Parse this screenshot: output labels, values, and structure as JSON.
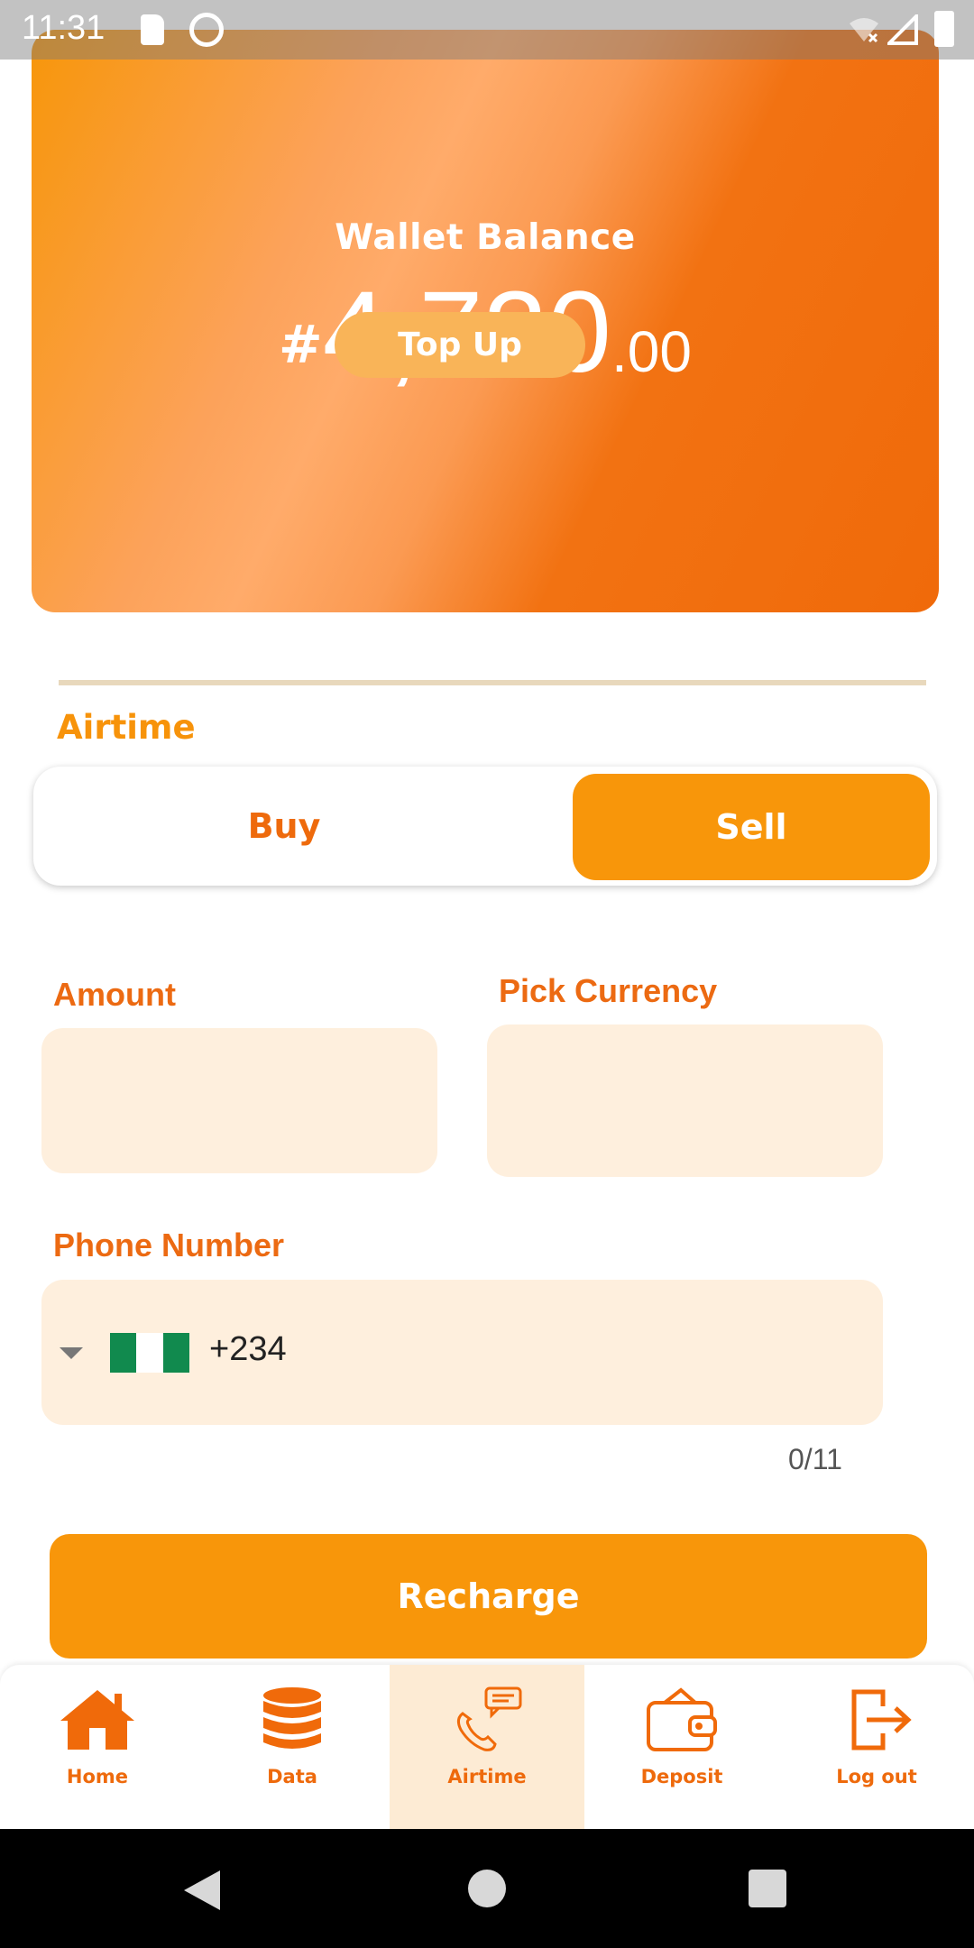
{
  "status_bar": {
    "time": "11:31"
  },
  "wallet": {
    "title": "Wallet Balance",
    "currency_symbol": "#",
    "amount_integer": "4,720",
    "amount_decimal": ".00",
    "topup_label": "Top Up"
  },
  "section": {
    "title": "Airtime"
  },
  "toggle": {
    "buy_label": "Buy",
    "sell_label": "Sell",
    "selected": "Sell"
  },
  "form": {
    "amount_label": "Amount",
    "amount_value": "",
    "currency_label": "Pick Currency",
    "currency_value": "",
    "phone_label": "Phone Number",
    "phone_code": "+234",
    "phone_value": "",
    "char_counter": "0/11"
  },
  "recharge_label": "Recharge",
  "bottom_nav": {
    "items": [
      {
        "label": "Home",
        "icon": "home-icon"
      },
      {
        "label": "Data",
        "icon": "database-icon"
      },
      {
        "label": "Airtime",
        "icon": "phone-chat-icon"
      },
      {
        "label": "Deposit",
        "icon": "wallet-icon"
      },
      {
        "label": "Log out",
        "icon": "logout-icon"
      }
    ],
    "active": "Airtime"
  },
  "colors": {
    "accent": "#f8960a",
    "accent_dark": "#ee6a0c",
    "field_bg": "#feefdd",
    "active_tab_bg": "#fdebd4"
  }
}
